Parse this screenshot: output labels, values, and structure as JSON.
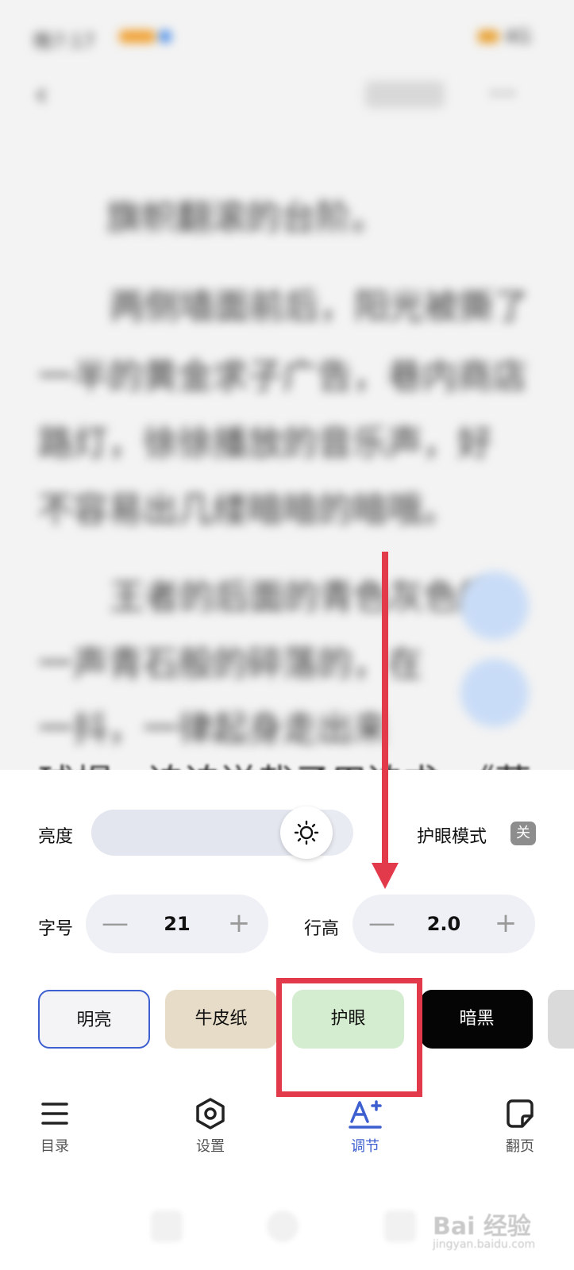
{
  "status_bar": {
    "time": "晚7:17",
    "right_status": "4G",
    "battery": "58%"
  },
  "reader": {
    "top_button": "",
    "paragraphs": [
      "旗帜翻滚的台阶。",
      "两侧墙面前后，阳光被撕了",
      "一半的黄金求子广告，巷内商店",
      "路灯，徐徐播放的音乐声，好",
      "不容易出几缕暗暗的暗哦。",
      "王者的后面的青色灰色的",
      "一声青石般的碎落的，在",
      "一抖，一律起身走出来"
    ],
    "last_visible_line": "球帽，迫迫送栽子用迫求，《莽"
  },
  "panel": {
    "brightness_label": "亮度",
    "brightness_level": 0.9,
    "eye_mode_label": "护眼模式",
    "eye_mode_toggle": "关",
    "font_size_label": "字号",
    "font_size_value": "21",
    "line_height_label": "行高",
    "line_height_value": "2.0",
    "minus_symbol": "—",
    "plus_symbol": "+",
    "themes": [
      "明亮",
      "牛皮纸",
      "护眼",
      "暗黑"
    ]
  },
  "bottom_nav": {
    "items": [
      {
        "label": "目录",
        "icon": "list-icon"
      },
      {
        "label": "设置",
        "icon": "hexagon-settings-icon"
      },
      {
        "label": "调节",
        "icon": "font-adjust-icon"
      },
      {
        "label": "翻页",
        "icon": "page-flip-icon"
      }
    ]
  },
  "watermark": {
    "brand": "Bai 经验",
    "sub": "jingyan.baidu.com"
  },
  "colors": {
    "accent": "#3d5fcf",
    "annotation_red": "#e33a4b",
    "eye_theme": "#d4eccf",
    "kraft_theme": "#e6dcc7",
    "dark_theme": "#050505"
  }
}
